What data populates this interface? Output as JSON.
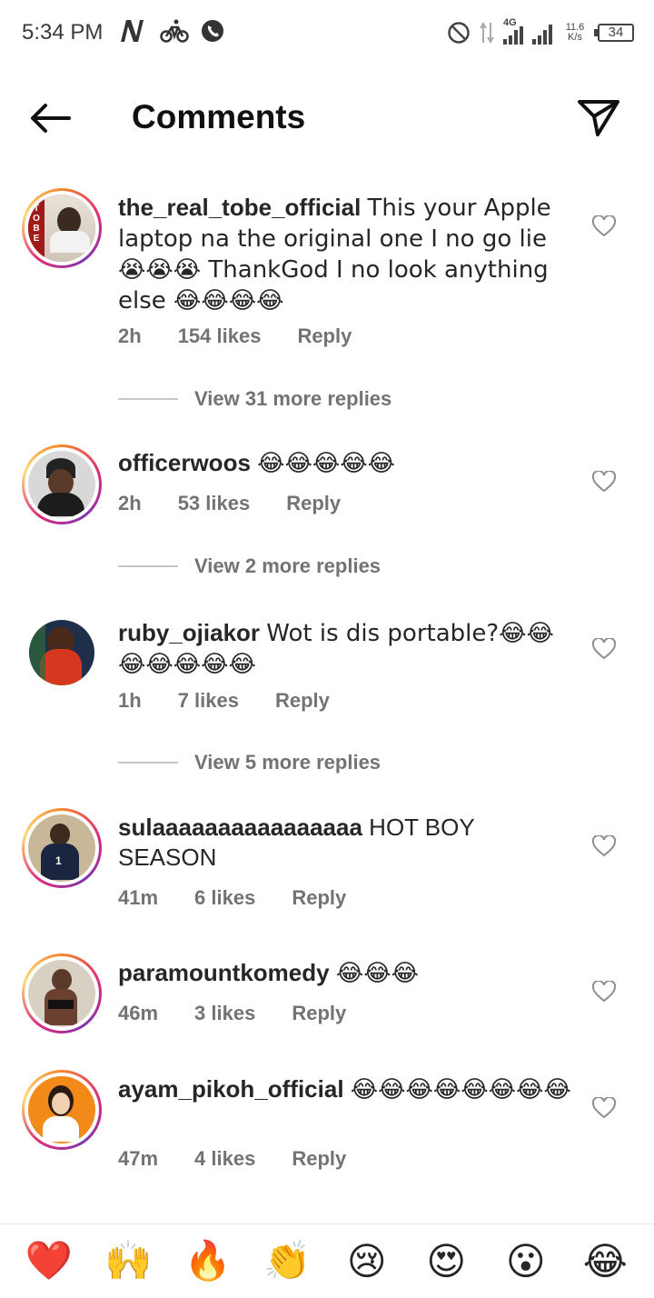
{
  "status_bar": {
    "time": "5:34 PM",
    "network": "4G",
    "speed_value": "11.6",
    "speed_unit": "K/s",
    "battery": "34"
  },
  "header": {
    "title": "Comments"
  },
  "comments": [
    {
      "username": "the_real_tobe_official",
      "text": "This your Apple laptop na the original one I no go lie😭😭😭 ThankGod I no look anything else 😂😂😂😂",
      "time": "2h",
      "likes": "154 likes",
      "reply": "Reply",
      "view_more": "View 31 more replies"
    },
    {
      "username": "officerwoos",
      "text": "😂😂😂😂😂",
      "time": "2h",
      "likes": "53 likes",
      "reply": "Reply",
      "view_more": "View 2 more replies"
    },
    {
      "username": "ruby_ojiakor",
      "text": "Wot is dis portable?😂😂😂😂😂😂😂",
      "time": "1h",
      "likes": "7 likes",
      "reply": "Reply",
      "view_more": "View 5 more replies"
    },
    {
      "username": "sulaaaaaaaaaaaaaaaa",
      "text": "HOT BOY SEASON",
      "time": "41m",
      "likes": "6 likes",
      "reply": "Reply"
    },
    {
      "username": "paramountkomedy",
      "text": "😂😂😂",
      "time": "46m",
      "likes": "3 likes",
      "reply": "Reply"
    },
    {
      "username": "ayam_pikoh_official",
      "text": "😂😂😂😂😂😂😂😂",
      "time": "47m",
      "likes": "4 likes",
      "reply": "Reply"
    }
  ],
  "reactions": [
    "❤️",
    "🙌",
    "🔥",
    "👏",
    "😢",
    "😍",
    "😮",
    "😂"
  ],
  "colors": {
    "ring_start": "#f58529",
    "ring_mid": "#dd2a7b",
    "meta_text": "#737373"
  }
}
